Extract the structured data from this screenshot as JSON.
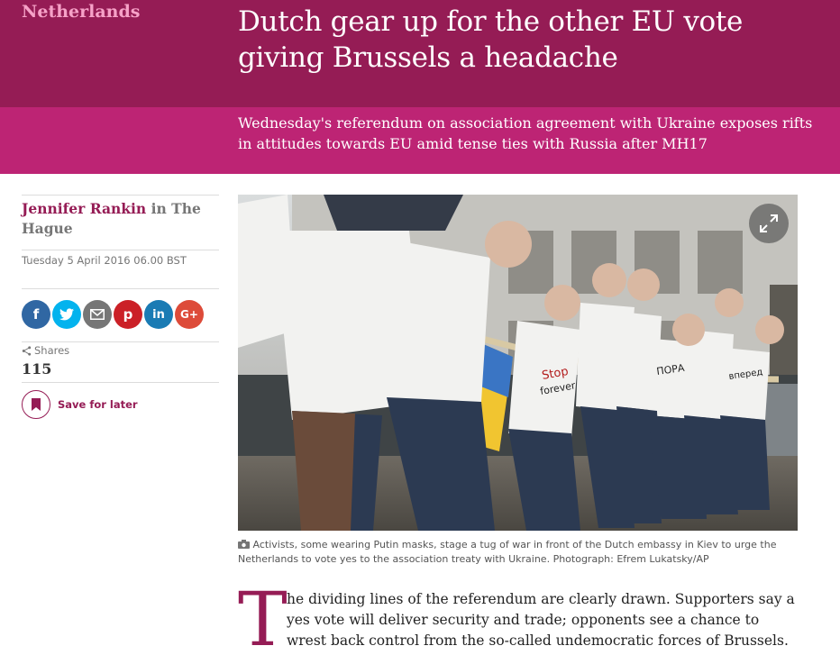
{
  "header": {
    "section": "Netherlands",
    "headline": "Dutch gear up for the other EU vote giving Brussels a headache",
    "standfirst": "Wednesday's referendum on association agreement with Ukraine exposes rifts in attitudes towards EU amid tense ties with Russia after MH17"
  },
  "byline": {
    "author": "Jennifer Rankin",
    "in": "in",
    "location": "The Hague",
    "date": "Tuesday 5 April 2016 06.00 BST"
  },
  "share": {
    "buttons": [
      {
        "icon": "facebook-icon",
        "glyph": "f",
        "color": "#3067a3"
      },
      {
        "icon": "twitter-icon",
        "glyph": "t",
        "color": "#03b3ee"
      },
      {
        "icon": "email-icon",
        "glyph": "✉",
        "color": "#767676"
      },
      {
        "icon": "pinterest-icon",
        "glyph": "p",
        "color": "#cb2027"
      },
      {
        "icon": "linkedin-icon",
        "glyph": "in",
        "color": "#1a7bb4"
      },
      {
        "icon": "google-plus-icon",
        "glyph": "G+",
        "color": "#dd4b39"
      }
    ],
    "shares_label": "Shares",
    "shares_count": "115",
    "save_label": "Save for later"
  },
  "photo": {
    "sign_text_1": "Stop",
    "sign_text_2": "forever",
    "sign_text_3": "ПОРА",
    "sign_text_4": "вперед"
  },
  "caption": "Activists, some wearing Putin masks, stage a tug of war in front of the Dutch embassy in Kiev to urge the Netherlands to vote yes to the association treaty with Ukraine. Photograph: Efrem Lukatsky/AP",
  "body": {
    "dropcap": "T",
    "first_paragraph": "he dividing lines of the referendum are clearly drawn. Supporters say a yes vote will deliver security and trade; opponents see a chance to wrest back control from the so-called undemocratic forces of Brussels. Accusations of"
  },
  "colors": {
    "header_dark": "#951c55",
    "header_light": "#bd2474",
    "section_label": "#f6a2c8"
  }
}
